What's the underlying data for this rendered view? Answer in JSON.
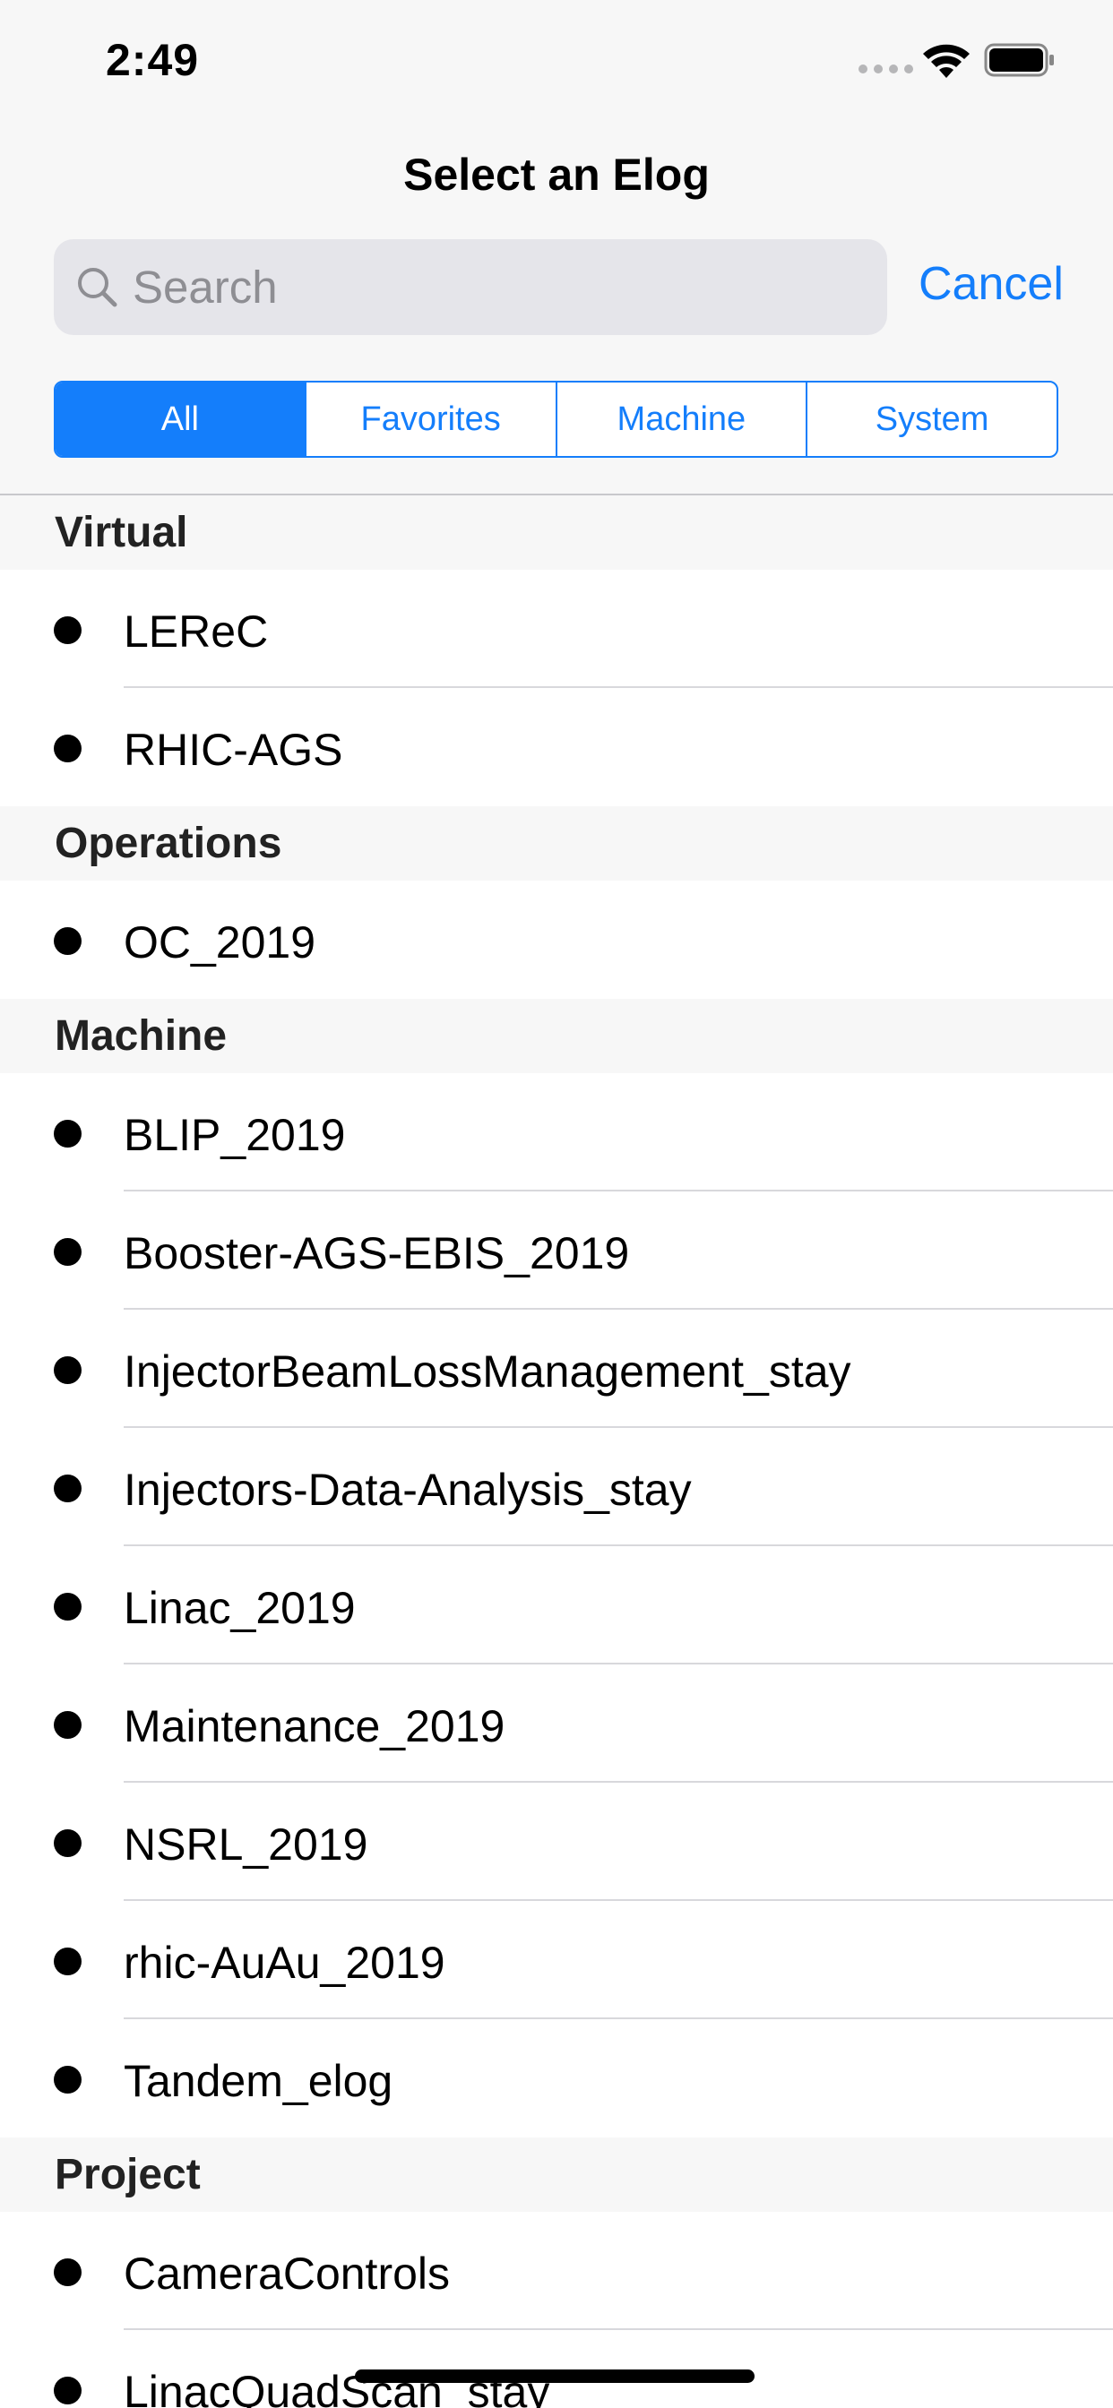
{
  "status_bar": {
    "time": "2:49"
  },
  "header": {
    "title": "Select an Elog",
    "cancel_label": "Cancel"
  },
  "search": {
    "placeholder": "Search",
    "value": ""
  },
  "segments": [
    {
      "label": "All",
      "selected": true
    },
    {
      "label": "Favorites",
      "selected": false
    },
    {
      "label": "Machine",
      "selected": false
    },
    {
      "label": "System",
      "selected": false
    }
  ],
  "sections": [
    {
      "title": "Virtual",
      "items": [
        "LEReC",
        "RHIC-AGS"
      ]
    },
    {
      "title": "Operations",
      "items": [
        "OC_2019"
      ]
    },
    {
      "title": "Machine",
      "items": [
        "BLIP_2019",
        "Booster-AGS-EBIS_2019",
        "InjectorBeamLossManagement_stay",
        "Injectors-Data-Analysis_stay",
        "Linac_2019",
        "Maintenance_2019",
        "NSRL_2019",
        "rhic-AuAu_2019",
        "Tandem_elog"
      ]
    },
    {
      "title": "Project",
      "items": [
        "CameraControls",
        "LinacQuadScan_stay"
      ]
    }
  ],
  "colors": {
    "accent": "#147efb",
    "header_bg": "#f7f7f7",
    "search_bg": "#e5e5ea"
  },
  "icons": {
    "search": "search-icon",
    "wifi": "wifi-icon",
    "battery": "battery-icon",
    "signal": "cellular-signal-icon",
    "bullet": "bullet-icon"
  }
}
